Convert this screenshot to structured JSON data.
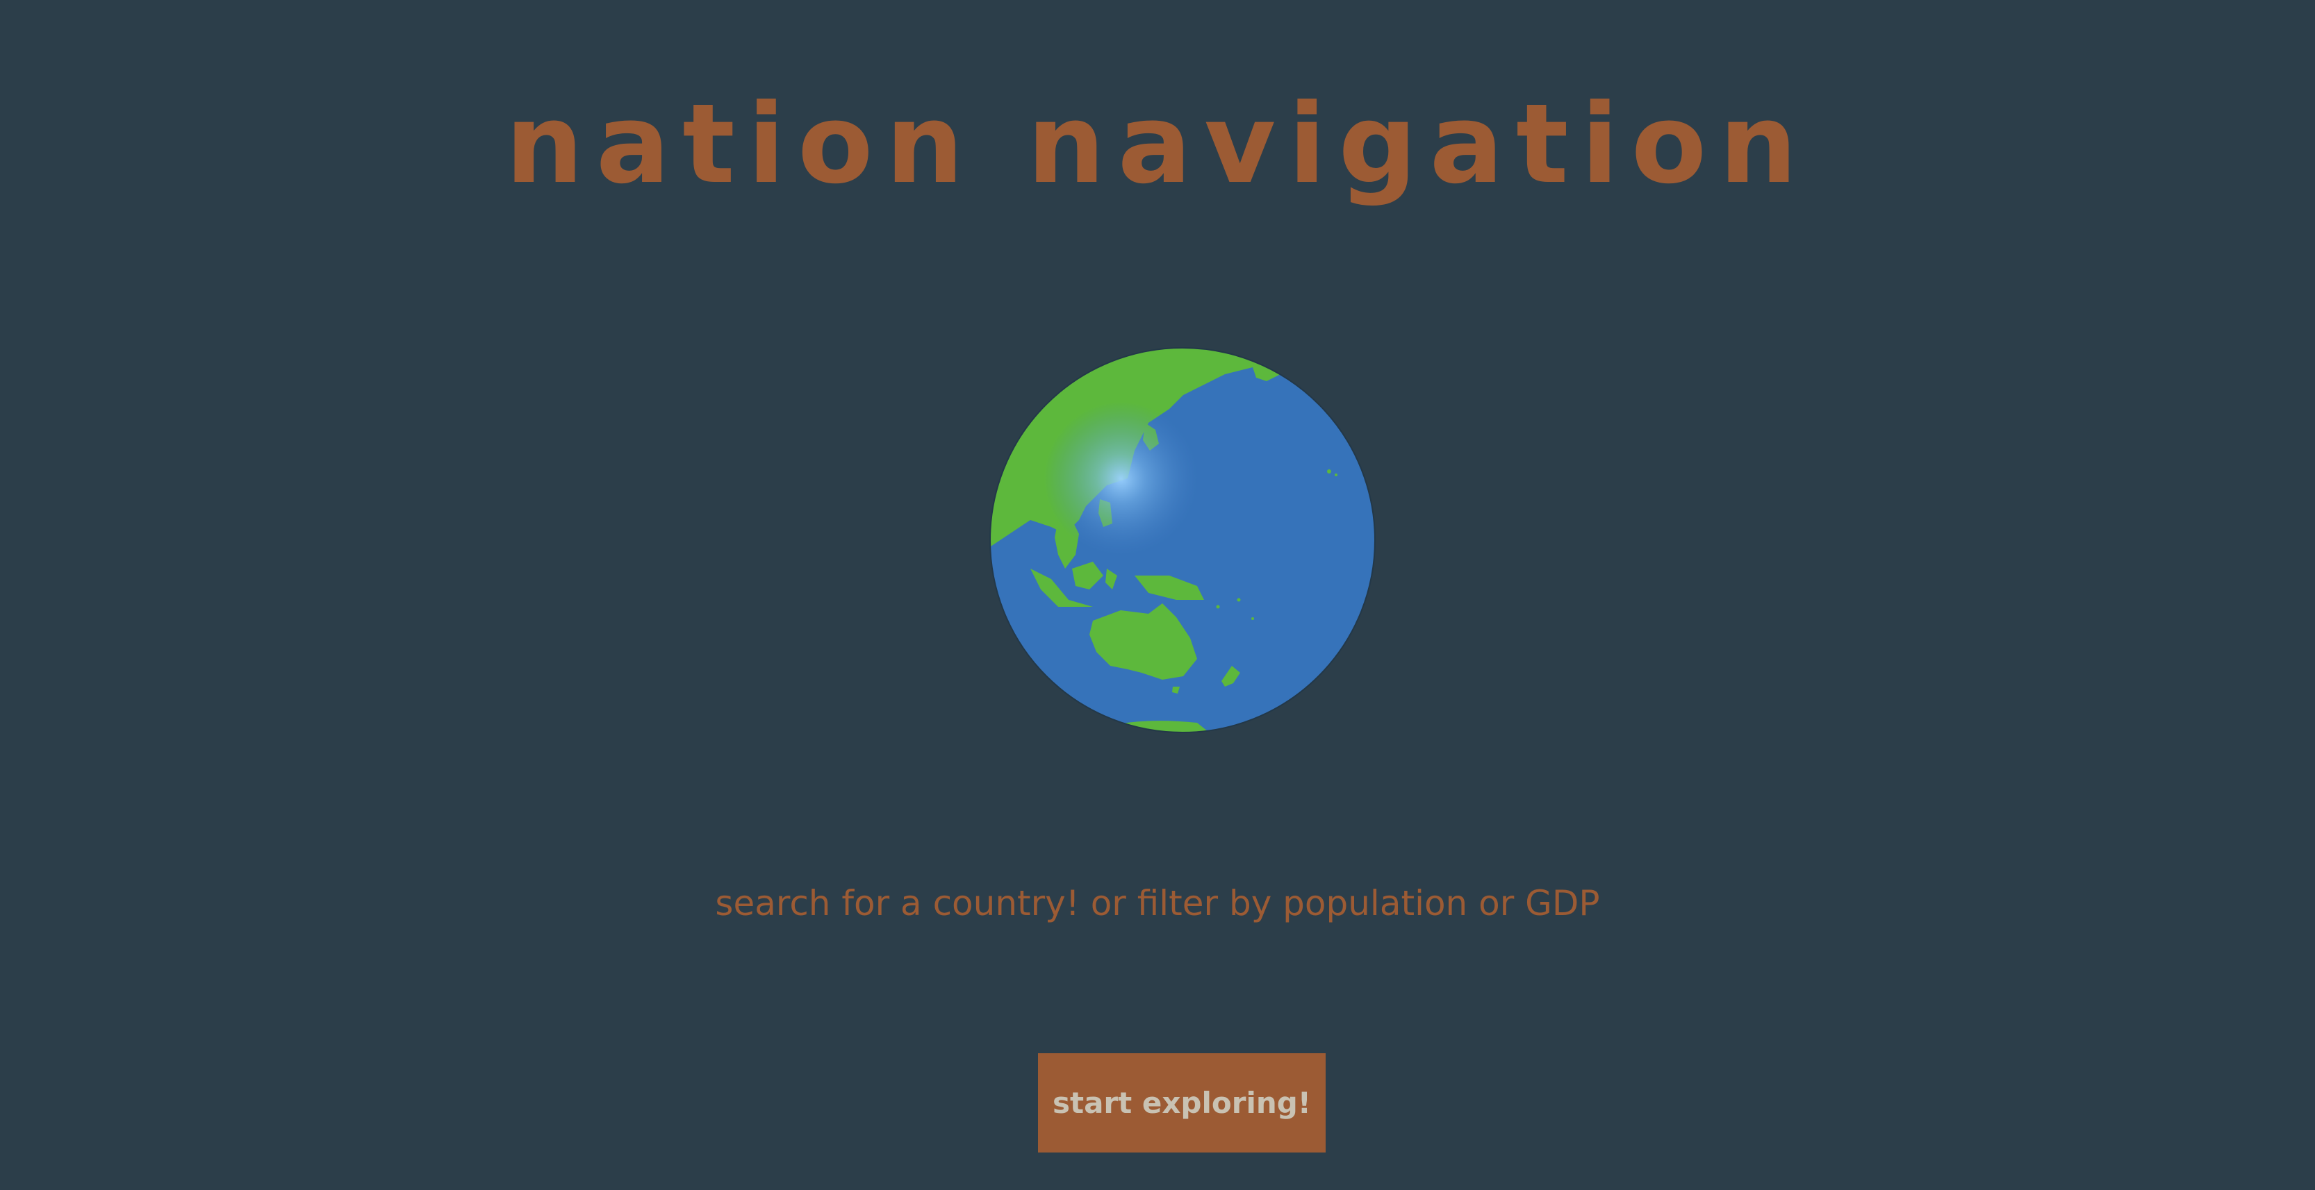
{
  "header": {
    "title": "nation navigation"
  },
  "hero": {
    "globe_icon": "globe-icon",
    "tagline": "search for a country! or filter by population or GDP"
  },
  "actions": {
    "start_label": "start exploring!"
  },
  "colors": {
    "background": "#2c3e4a",
    "accent": "#9c5b34",
    "button_text": "#c9c2b3",
    "ocean": "#3673ba",
    "land": "#5db83c"
  }
}
